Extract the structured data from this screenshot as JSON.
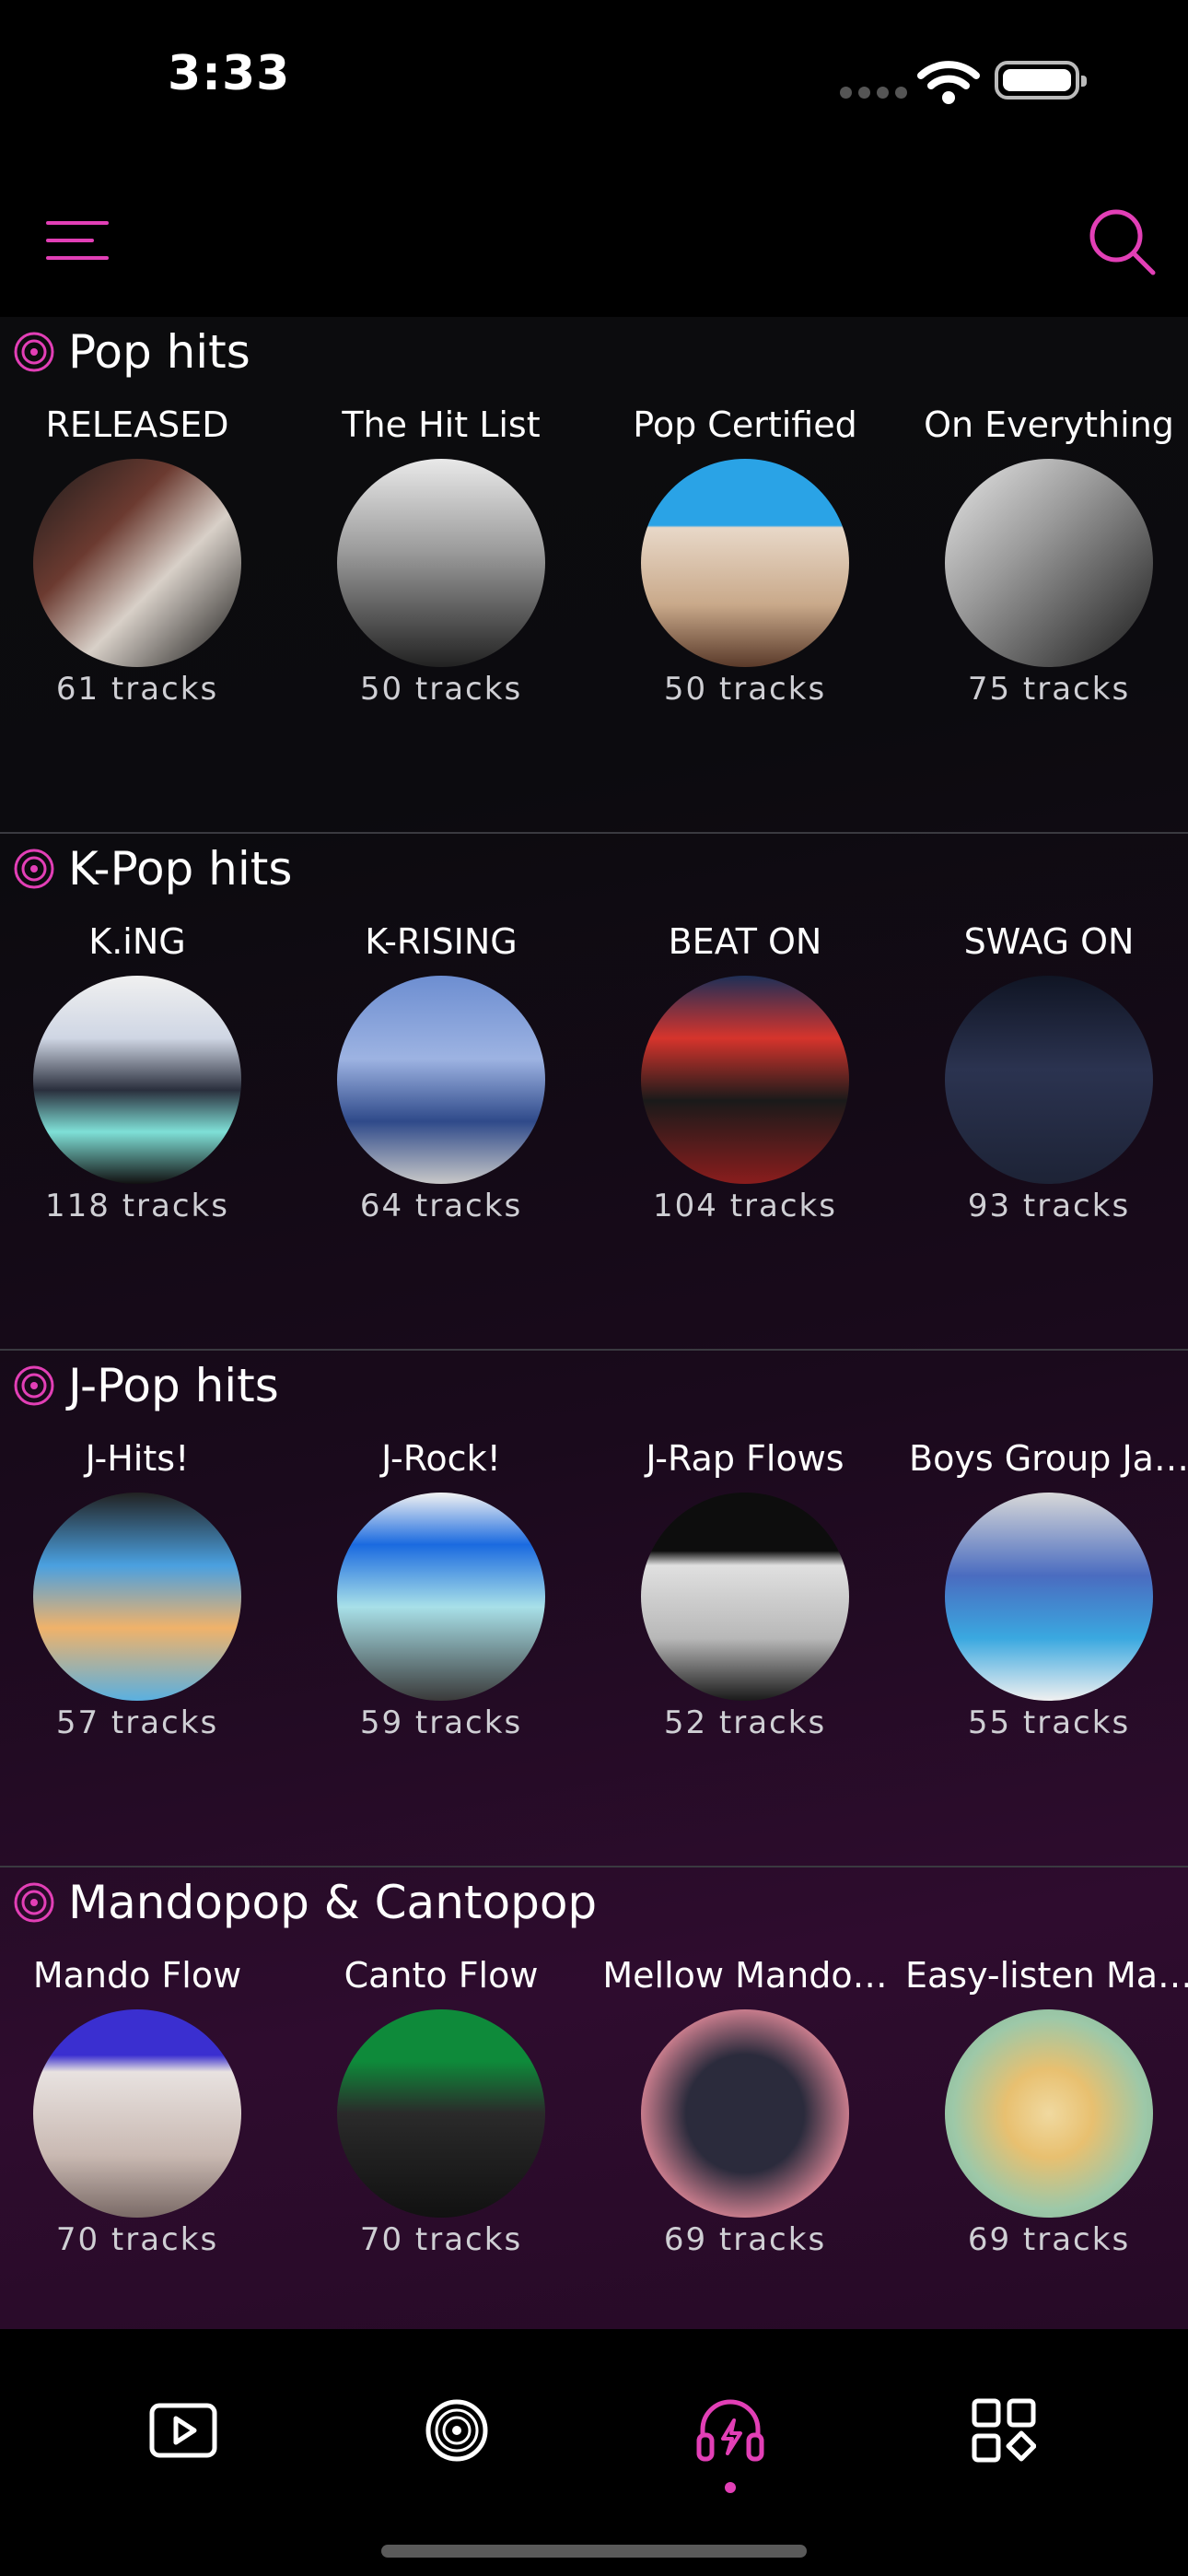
{
  "status": {
    "time": "3:33"
  },
  "accent_color": "#e23fb6",
  "sections": [
    {
      "title": "Pop hits",
      "items": [
        {
          "name": "RELEASED",
          "count": "61  tracks",
          "art": "art-released"
        },
        {
          "name": "The Hit List",
          "count": "50  tracks",
          "art": "art-hitlist"
        },
        {
          "name": "Pop Certified",
          "count": "50  tracks",
          "art": "art-popcert"
        },
        {
          "name": "On Everything",
          "count": "75  tracks",
          "art": "art-oneverything"
        }
      ]
    },
    {
      "title": "K-Pop hits",
      "items": [
        {
          "name": "K.iNG",
          "count": "118  tracks",
          "art": "art-king"
        },
        {
          "name": "K-RISING",
          "count": "64  tracks",
          "art": "art-krising"
        },
        {
          "name": "BEAT ON",
          "count": "104  tracks",
          "art": "art-beaton"
        },
        {
          "name": "SWAG ON",
          "count": "93  tracks",
          "art": "art-swagon"
        }
      ]
    },
    {
      "title": "J-Pop hits",
      "items": [
        {
          "name": "J-Hits!",
          "count": "57  tracks",
          "art": "art-jhits"
        },
        {
          "name": "J-Rock!",
          "count": "59  tracks",
          "art": "art-jrock"
        },
        {
          "name": "J-Rap Flows",
          "count": "52  tracks",
          "art": "art-jrap"
        },
        {
          "name": "Boys Group Ja…",
          "count": "55  tracks",
          "art": "art-boysgroup"
        }
      ]
    },
    {
      "title": "Mandopop & Cantopop",
      "items": [
        {
          "name": "Mando Flow",
          "count": "70  tracks",
          "art": "art-mando"
        },
        {
          "name": "Canto Flow",
          "count": "70  tracks",
          "art": "art-canto"
        },
        {
          "name": "Mellow Mando…",
          "count": "69  tracks",
          "art": "art-mellow"
        },
        {
          "name": "Easy-listen Ma…",
          "count": "69  tracks",
          "art": "art-easylisten"
        }
      ]
    }
  ],
  "tabs": [
    {
      "icon": "play-icon",
      "active": false
    },
    {
      "icon": "vinyl-icon",
      "active": false
    },
    {
      "icon": "headphones-icon",
      "active": true
    },
    {
      "icon": "grid-icon",
      "active": false
    }
  ]
}
